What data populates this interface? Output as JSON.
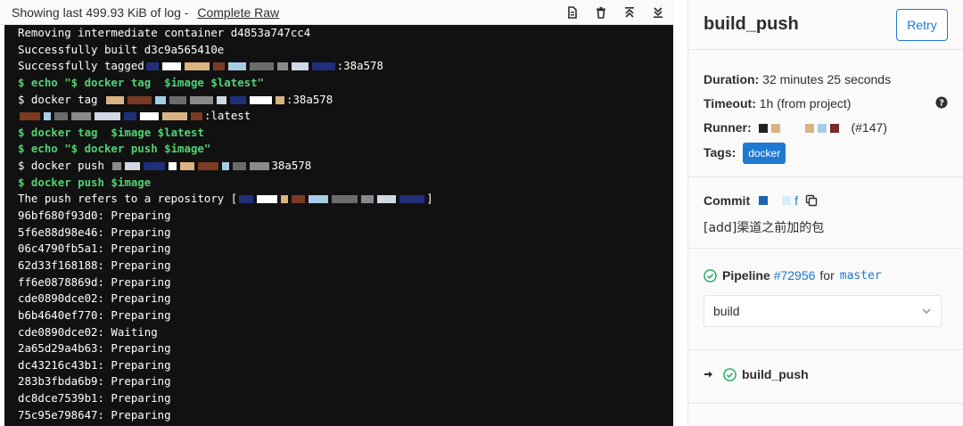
{
  "log": {
    "showing_text": "Showing last 499.93 KiB of log - ",
    "raw_link": "Complete Raw",
    "lines": [
      {
        "text": "Removing intermediate container d4853a747cc4",
        "type": "out"
      },
      {
        "text": "Successfully built d3c9a565410e",
        "type": "out"
      },
      {
        "text": "Successfully tagged",
        "suffix": ":38a578",
        "type": "out",
        "redacted": true
      },
      {
        "text": "$ echo \"$ docker tag  $image $latest\"",
        "type": "cmd"
      },
      {
        "text": "$ docker tag ",
        "suffix": ":38a578",
        "type": "out",
        "redacted": true
      },
      {
        "text": "",
        "suffix": ":latest",
        "type": "out",
        "redacted": true
      },
      {
        "text": "$ docker tag  $image $latest",
        "type": "cmd"
      },
      {
        "text": "$ echo \"$ docker push $image\"",
        "type": "cmd"
      },
      {
        "text": "$ docker push ",
        "suffix": "38a578",
        "type": "out",
        "redacted": true
      },
      {
        "text": "$ docker push $image",
        "type": "cmd"
      },
      {
        "text": "The push refers to a repository [",
        "suffix": "]",
        "type": "out",
        "redacted": true
      },
      {
        "text": "96bf680f93d0: Preparing",
        "type": "out"
      },
      {
        "text": "5f6e88d98e46: Preparing",
        "type": "out"
      },
      {
        "text": "06c4790fb5a1: Preparing",
        "type": "out"
      },
      {
        "text": "62d33f168188: Preparing",
        "type": "out"
      },
      {
        "text": "ff6e0878869d: Preparing",
        "type": "out"
      },
      {
        "text": "cde0890dce02: Preparing",
        "type": "out"
      },
      {
        "text": "b6b4640ef770: Preparing",
        "type": "out"
      },
      {
        "text": "cde0890dce02: Waiting",
        "type": "out"
      },
      {
        "text": "2a65d29a4b63: Preparing",
        "type": "out"
      },
      {
        "text": "dc43216c43b1: Preparing",
        "type": "out"
      },
      {
        "text": "283b3fbda6b9: Preparing",
        "type": "out"
      },
      {
        "text": "dc8dce7539b1: Preparing",
        "type": "out"
      },
      {
        "text": "75c95e798647: Preparing",
        "type": "out"
      }
    ]
  },
  "sidebar": {
    "title": "build_push",
    "retry_label": "Retry",
    "duration_label": "Duration:",
    "duration_value": "32 minutes 25 seconds",
    "timeout_label": "Timeout:",
    "timeout_value": "1h (from project)",
    "runner_label": "Runner:",
    "runner_value": "(#147)",
    "tags_label": "Tags:",
    "tag": "docker",
    "commit_label": "Commit",
    "commit_sha_tail": "f",
    "commit_message": "[add]渠道之前加的包",
    "pipeline_label": "Pipeline",
    "pipeline_id": "#72956",
    "pipeline_for": "for",
    "branch": "master",
    "stage": "build",
    "job_name": "build_push"
  },
  "colors": {
    "accent": "#1f78d1",
    "success": "#1aaa55",
    "terminal_bg": "#111111",
    "terminal_cmd": "#52d273"
  }
}
